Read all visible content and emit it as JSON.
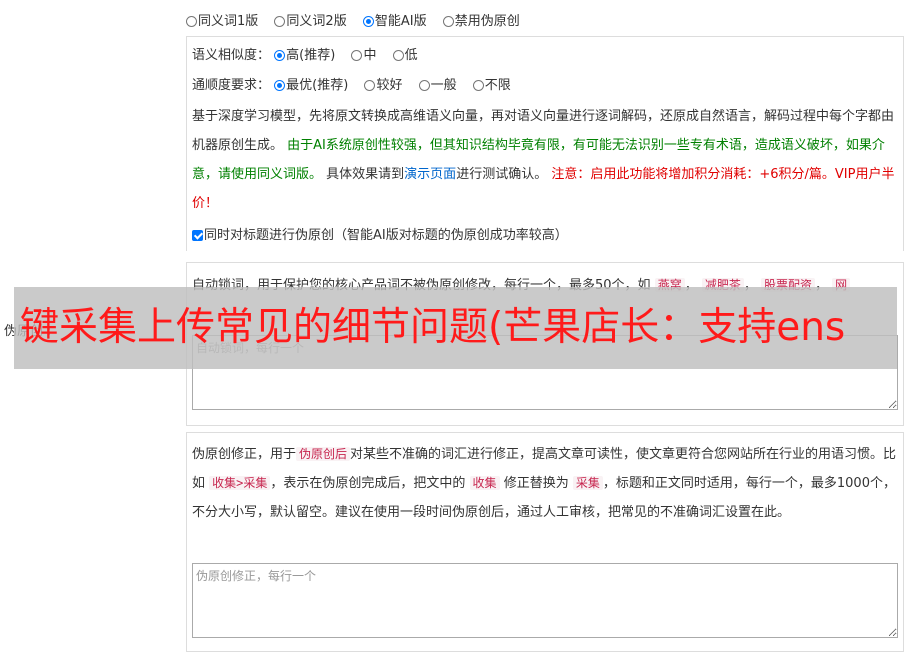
{
  "mode_options": [
    {
      "label": "同义词1版",
      "checked": false
    },
    {
      "label": "同义词2版",
      "checked": false
    },
    {
      "label": "智能AI版",
      "checked": true
    },
    {
      "label": "禁用伪原创",
      "checked": false
    }
  ],
  "similarity": {
    "label": "语义相似度：",
    "options": [
      {
        "label": "高(推荐)",
        "checked": true
      },
      {
        "label": "中",
        "checked": false
      },
      {
        "label": "低",
        "checked": false
      }
    ]
  },
  "fluency": {
    "label": "通顺度要求：",
    "options": [
      {
        "label": "最优(推荐)",
        "checked": true
      },
      {
        "label": "较好",
        "checked": false
      },
      {
        "label": "一般",
        "checked": false
      },
      {
        "label": "不限",
        "checked": false
      }
    ]
  },
  "ai_desc": {
    "part1": "基于深度学习模型，先将原文转换成高维语义向量，再对语义向量进行逐词解码，还原成自然语言，解码过程中每个字都由机器原创生成。",
    "green": "由于AI系统原创性较强，但其知识结构毕竟有限，有可能无法识别一些专有术语，造成语义破坏，如果介意，请使用同义词版。",
    "part2": "具体效果请到",
    "link": "演示页面",
    "part3": "进行测试确认。",
    "red": "注意：启用此功能将增加积分消耗：+6积分/篇。VIP用户半价！"
  },
  "title_checkbox": {
    "label": "同时对标题进行伪原创（智能AI版对标题的伪原创成功率较高）",
    "checked": true
  },
  "lock_words": {
    "desc_prefix": "自动锁词，用于保护您的核心产品词不被伪原创修改，每行一个，最多50个，如",
    "examples": [
      "燕窝",
      "减肥茶",
      "股票配资",
      "网"
    ],
    "placeholder": "自动锁词，每行一个"
  },
  "side_label": "伪原创 :",
  "correction": {
    "s1": "伪原创修正，用于",
    "c1": "伪原创后",
    "s2": "对某些不准确的词汇进行修正，提高文章可读性，使文章更符合您网站所在行业的用语习惯。比如",
    "c2": "收集>采集",
    "s3": "，表示在伪原创完成后，把文中的",
    "c3": "收集",
    "s4": "修正替换为",
    "c4": "采集",
    "s5": "，标题和正文同时适用，每行一个，最多1000个，不分大小写，默认留空。建议在使用一段时间伪原创后，通过人工审核，把常见的不准确词汇设置在此。",
    "placeholder": "伪原创修正，每行一个"
  },
  "watermark": "键采集上传常见的细节问题(芒果店长：支持ens"
}
